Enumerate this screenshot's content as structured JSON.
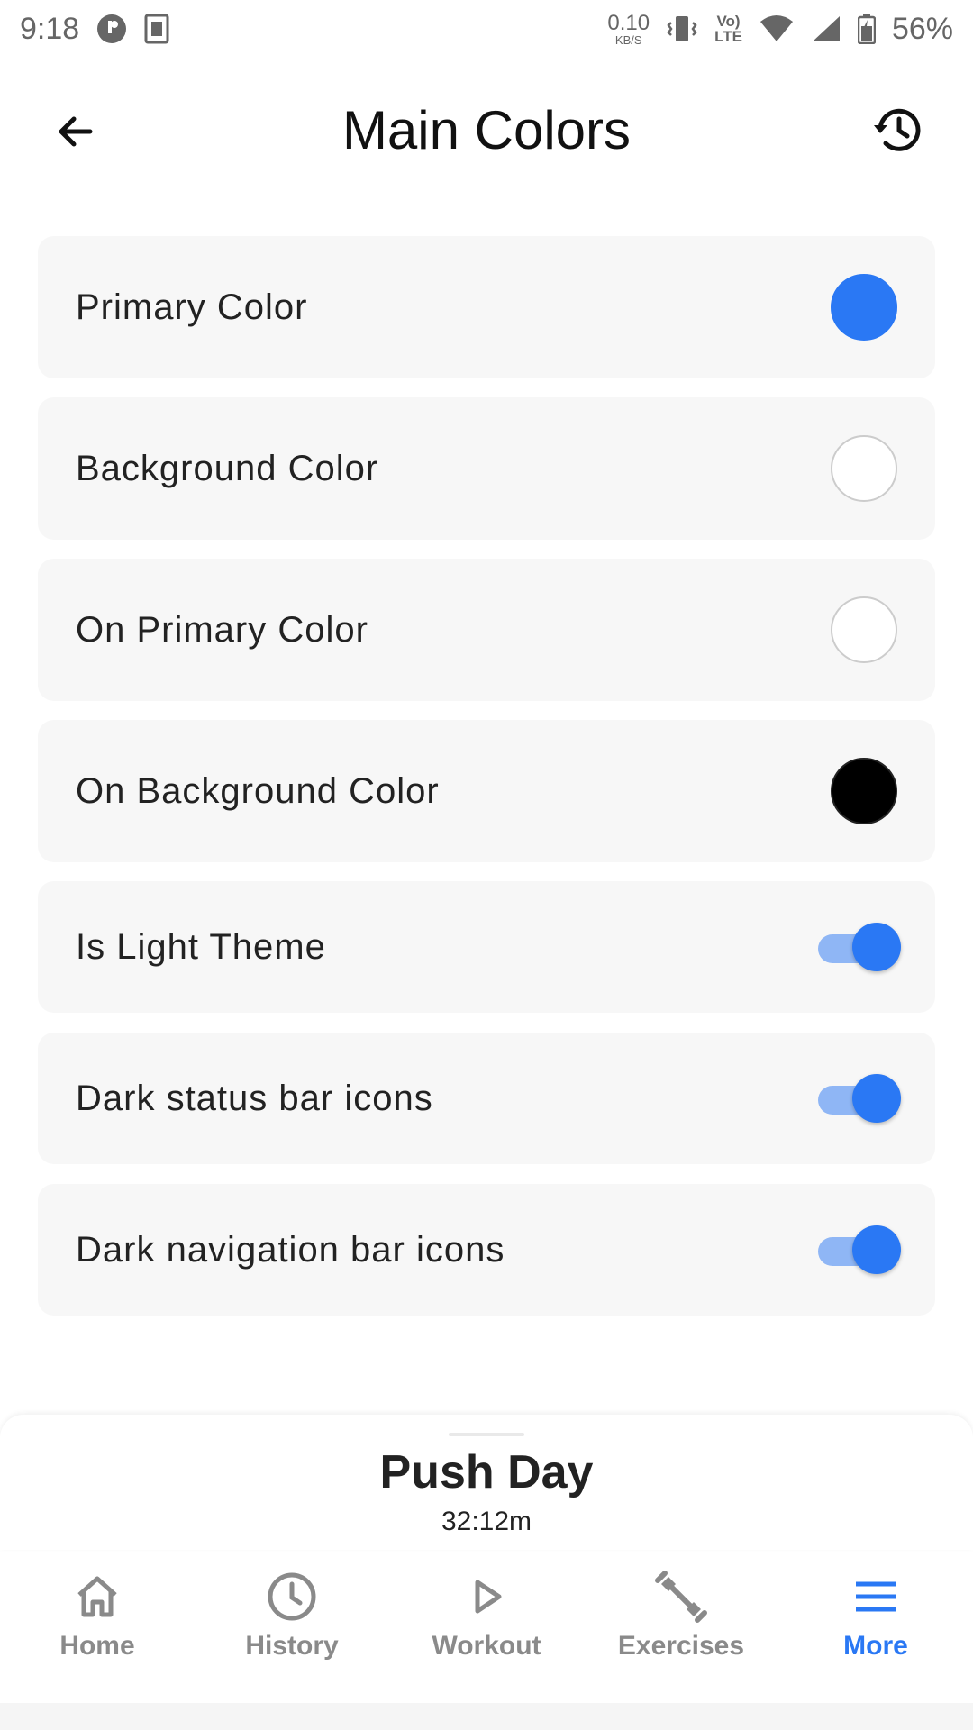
{
  "status_bar": {
    "time": "9:18",
    "net_speed_value": "0.10",
    "net_speed_unit": "KB/S",
    "volte_top": "Vo)",
    "volte_bottom": "LTE",
    "battery": "56%"
  },
  "app_bar": {
    "title": "Main Colors",
    "back_icon": "arrow-left-icon",
    "history_icon": "history-icon"
  },
  "settings": {
    "colors": [
      {
        "label": "Primary Color",
        "swatch": "#2a78f4"
      },
      {
        "label": "Background Color",
        "swatch": "#ffffff"
      },
      {
        "label": "On Primary Color",
        "swatch": "#ffffff"
      },
      {
        "label": "On Background Color",
        "swatch": "#000000"
      }
    ],
    "toggles": [
      {
        "label": "Is Light Theme",
        "on": true
      },
      {
        "label": "Dark status bar icons",
        "on": true
      },
      {
        "label": "Dark navigation bar icons",
        "on": true
      }
    ]
  },
  "mini_player": {
    "workout_name": "Push Day",
    "timer": "32:12m"
  },
  "bottom_nav": {
    "items": [
      {
        "label": "Home",
        "icon": "home-icon",
        "active": false
      },
      {
        "label": "History",
        "icon": "clock-icon",
        "active": false
      },
      {
        "label": "Workout",
        "icon": "play-icon",
        "active": false
      },
      {
        "label": "Exercises",
        "icon": "dumbbell-icon",
        "active": false
      },
      {
        "label": "More",
        "icon": "menu-icon",
        "active": true
      }
    ]
  },
  "colors": {
    "accent": "#2a78f4",
    "accent_light": "#8fb6f5",
    "inactive": "#8a8a8a",
    "card_bg": "#f7f7f7"
  }
}
